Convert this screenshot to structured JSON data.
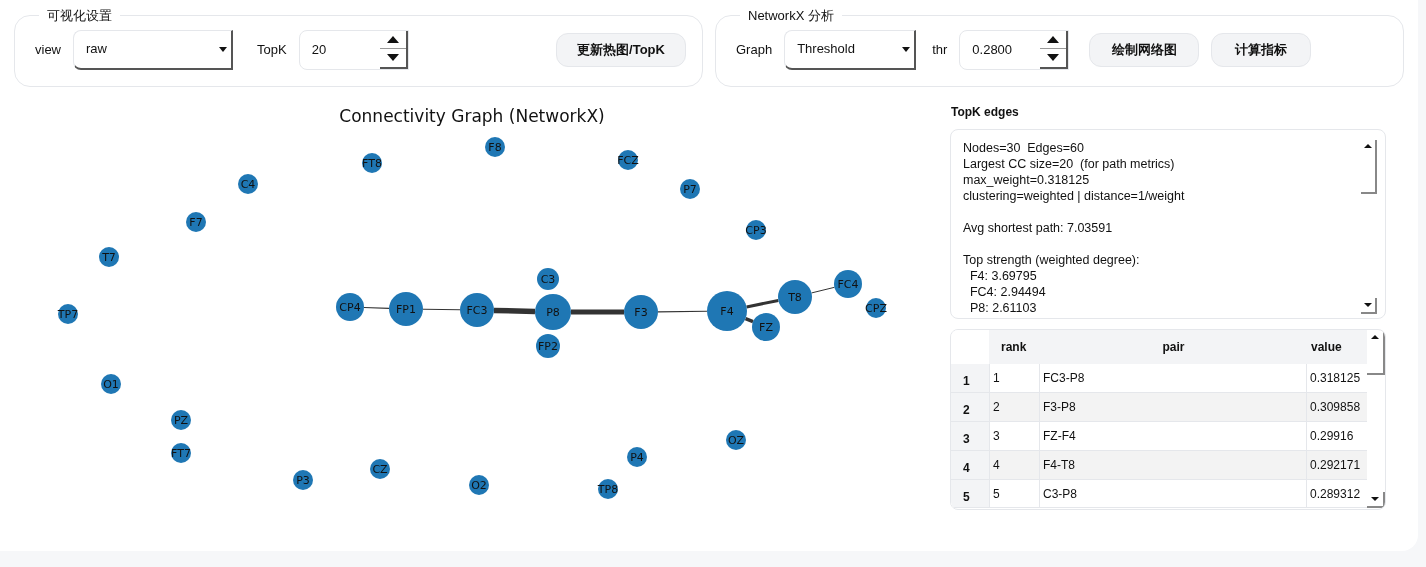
{
  "settings": {
    "legend": "可视化设置",
    "view": {
      "label": "view",
      "value": "raw"
    },
    "topk": {
      "label": "TopK",
      "value": "20"
    },
    "button": "更新热图/TopK"
  },
  "networkx": {
    "legend": "NetworkX 分析",
    "graph": {
      "label": "Graph",
      "value": "Threshold"
    },
    "thr": {
      "label": "thr",
      "value": "0.2800"
    },
    "buttons": [
      "绘制网络图",
      "计算指标"
    ]
  },
  "graph": {
    "title": "Connectivity Graph (NetworkX)",
    "nodes": [
      {
        "label": "F8"
      },
      {
        "label": "FT8"
      },
      {
        "label": "FCZ"
      },
      {
        "label": "C4"
      },
      {
        "label": "P7"
      },
      {
        "label": "F7"
      },
      {
        "label": "CP3"
      },
      {
        "label": "T7"
      },
      {
        "label": "TP7"
      },
      {
        "label": "CP4"
      },
      {
        "label": "FP1"
      },
      {
        "label": "FC3"
      },
      {
        "label": "C3"
      },
      {
        "label": "P8"
      },
      {
        "label": "FP2"
      },
      {
        "label": "F3"
      },
      {
        "label": "F4"
      },
      {
        "label": "T8"
      },
      {
        "label": "FC4"
      },
      {
        "label": "CPZ"
      },
      {
        "label": "FZ"
      },
      {
        "label": "O1"
      },
      {
        "label": "PZ"
      },
      {
        "label": "FT7"
      },
      {
        "label": "P3"
      },
      {
        "label": "CZ"
      },
      {
        "label": "O2"
      },
      {
        "label": "TP8"
      },
      {
        "label": "P4"
      },
      {
        "label": "OZ"
      }
    ]
  },
  "topk": {
    "heading": "TopK edges",
    "report": [
      [
        "Nodes=30  Edges=60",
        "Largest CC size=20  (for path metrics)",
        "max_weight=0.318125",
        "clustering=weighted | distance=1/weight"
      ],
      [
        "Avg shortest path: 7.03591"
      ],
      [
        "Top strength (weighted degree):",
        "  F4: 3.69795",
        "  FC4: 2.94494",
        "  P8: 2.61103"
      ]
    ],
    "table": {
      "columns": [
        "rank",
        "pair",
        "value"
      ],
      "rows": [
        {
          "index": "1",
          "cells": [
            "1",
            "FC3-P8",
            "0.318125"
          ]
        },
        {
          "index": "2",
          "cells": [
            "2",
            "F3-P8",
            "0.309858"
          ]
        },
        {
          "index": "3",
          "cells": [
            "3",
            "FZ-F4",
            "0.29916"
          ]
        },
        {
          "index": "4",
          "cells": [
            "4",
            "F4-T8",
            "0.292171"
          ]
        },
        {
          "index": "5",
          "cells": [
            "5",
            "C3-P8",
            "0.289312"
          ]
        }
      ]
    }
  }
}
